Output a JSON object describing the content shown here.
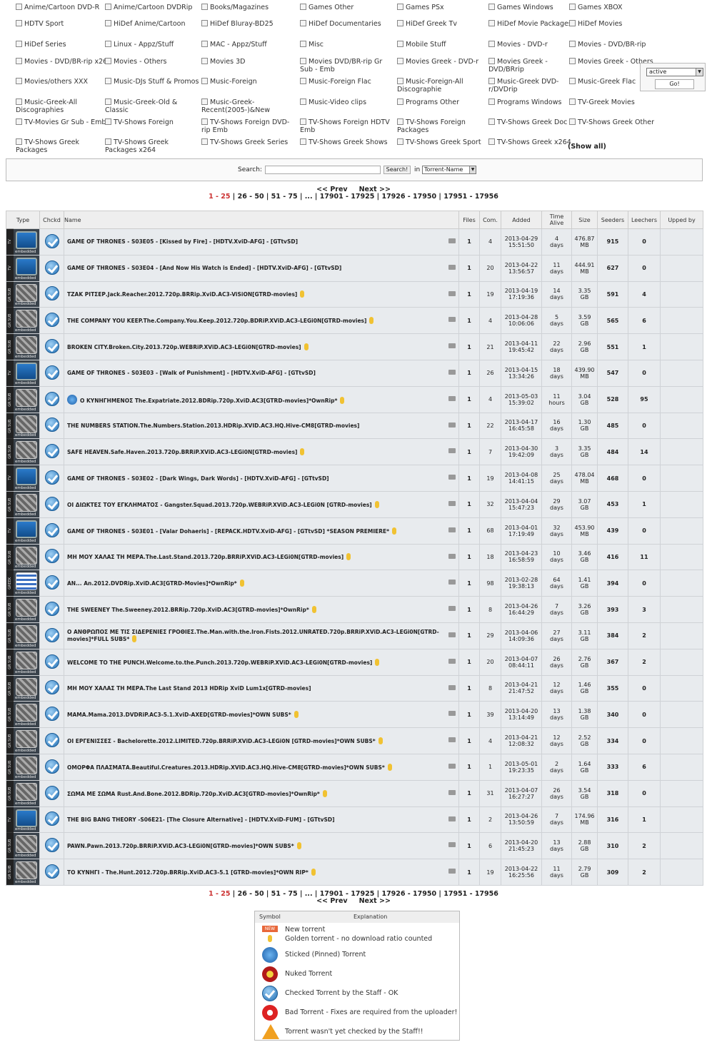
{
  "categories": [
    [
      "Anime/Cartoon DVD-R",
      "Anime/Cartoon DVDRip",
      "Books/Magazines",
      "Games Other",
      "Games PSx",
      "Games Windows",
      "Games XBOX"
    ],
    [
      "HDTV Sport",
      "HiDef Anime/Cartoon",
      "HiDef Bluray-BD25",
      "HiDef Documentaries",
      "HiDef Greek Tv",
      "HiDef Movie Packages",
      "HiDef Movies"
    ],
    [
      "HiDef Series",
      "Linux - Appz/Stuff",
      "MAC - Appz/Stuff",
      "Misc",
      "Mobile Stuff",
      "Movies - DVD-r",
      "Movies - DVD/BR-rip"
    ],
    [
      "Movies - DVD/BR-rip x264",
      "Movies - Others",
      "Movies 3D",
      "Movies DVD/BR-rip Gr Sub - Emb",
      "Movies Greek - DVD-r",
      "Movies Greek - DVD/BRrip",
      "Movies Greek - Others"
    ],
    [
      "Movies/others XXX",
      "Music-DJs Stuff & Promos",
      "Music-Foreign",
      "Music-Foreign Flac",
      "Music-Foreign-All Discographie",
      "Music-Greek DVD-r/DVDrip",
      "Music-Greek Flac"
    ],
    [
      "Music-Greek-All Discographies",
      "Music-Greek-Old & Classic",
      "Music-Greek-Recent(2005-)&New",
      "Music-Video clips",
      "Programs Other",
      "Programs Windows",
      "TV-Greek Movies"
    ],
    [
      "TV-Movies Gr Sub - Emb",
      "TV-Shows Foreign",
      "TV-Shows Foreign DVD-rip Emb",
      "TV-Shows Foreign HDTV Emb",
      "TV-Shows Foreign Packages",
      "TV-Shows Greek Doc",
      "TV-Shows Greek Other"
    ],
    [
      "TV-Shows Greek Packages",
      "TV-Shows Greek Packages x264",
      "TV-Shows Greek Series",
      "TV-Shows Greek Shows",
      "TV-Shows Greek Sport",
      "TV-Shows Greek x264"
    ]
  ],
  "show_all": "(Show all)",
  "status_select": "active",
  "go_button": "Go!",
  "search": {
    "label": "Search:",
    "button": "Search!",
    "in_label": "in",
    "field": "Torrent-Name"
  },
  "pager": {
    "prev": "<< Prev",
    "next": "Next >>",
    "pages": [
      "1 - 25",
      "26 - 50",
      "51 - 75",
      "...",
      "17901 - 17925",
      "17926 - 17950",
      "17951 - 17956"
    ]
  },
  "columns": [
    "Type",
    "Chckd",
    "Name",
    "Files",
    "Com.",
    "Added",
    "Time Alive",
    "Size",
    "Seeders",
    "Leechers",
    "Upped by"
  ],
  "rows": [
    {
      "type": "tv",
      "side": "TV",
      "name": "GAME OF THRONES - S03E05 - [Kissed by Fire] - [HDTV.XviD-AFG] - [GTtvSD]",
      "gold": false,
      "pin": false,
      "files": "1",
      "com": "4",
      "added1": "2013-04-29",
      "added2": "15:51:50",
      "alive1": "4",
      "alive2": "days",
      "size1": "476.87",
      "size2": "MB",
      "seeders": "915",
      "leechers": "0"
    },
    {
      "type": "tv",
      "side": "TV",
      "name": "GAME OF THRONES - S03E04 - [And Now His Watch is Ended] - [HDTV.XviD-AFG] - [GTtvSD]",
      "gold": false,
      "pin": false,
      "files": "1",
      "com": "20",
      "added1": "2013-04-22",
      "added2": "13:56:57",
      "alive1": "11",
      "alive2": "days",
      "size1": "444.91",
      "size2": "MB",
      "seeders": "627",
      "leechers": "0"
    },
    {
      "type": "mov",
      "side": "GR SUB",
      "name": "ΤΖΑΚ ΡΙΤΣΕΡ.Jack.Reacher.2012.720p.BRRip.XviD.AC3-ViSiON[GTRD-movies]",
      "gold": true,
      "pin": false,
      "files": "1",
      "com": "19",
      "added1": "2013-04-19",
      "added2": "17:19:36",
      "alive1": "14",
      "alive2": "days",
      "size1": "3.35",
      "size2": "GB",
      "seeders": "591",
      "leechers": "4"
    },
    {
      "type": "mov",
      "side": "GR SUB",
      "name": "THE COMPANY YOU KEEP.The.Company.You.Keep.2012.720p.BDRiP.XViD.AC3-LEGi0N[GTRD-movies]",
      "gold": true,
      "pin": false,
      "files": "1",
      "com": "4",
      "added1": "2013-04-28",
      "added2": "10:06:06",
      "alive1": "5",
      "alive2": "days",
      "size1": "3.59",
      "size2": "GB",
      "seeders": "565",
      "leechers": "6"
    },
    {
      "type": "mov",
      "side": "GR SUB",
      "name": "BROKEN CITY.Broken.City.2013.720p.WEBRiP.XViD.AC3-LEGi0N[GTRD-movies]",
      "gold": true,
      "pin": false,
      "files": "1",
      "com": "21",
      "added1": "2013-04-11",
      "added2": "19:45:42",
      "alive1": "22",
      "alive2": "days",
      "size1": "2.96",
      "size2": "GB",
      "seeders": "551",
      "leechers": "1"
    },
    {
      "type": "tv",
      "side": "TV",
      "name": "GAME OF THRONES - S03E03 - [Walk of Punishment] - [HDTV.XviD-AFG] - [GTtvSD]",
      "gold": false,
      "pin": false,
      "files": "1",
      "com": "26",
      "added1": "2013-04-15",
      "added2": "13:34:26",
      "alive1": "18",
      "alive2": "days",
      "size1": "439.90",
      "size2": "MB",
      "seeders": "547",
      "leechers": "0"
    },
    {
      "type": "mov",
      "side": "GR SUB",
      "name": "Ο ΚΥΝΗΓΗΜΕΝΟΣ The.Expatriate.2012.BDRip.720p.XviD.AC3[GTRD-movies]*OwnRip*",
      "gold": true,
      "pin": true,
      "files": "1",
      "com": "4",
      "added1": "2013-05-03",
      "added2": "15:39:02",
      "alive1": "11",
      "alive2": "hours",
      "size1": "3.04",
      "size2": "GB",
      "seeders": "528",
      "leechers": "95"
    },
    {
      "type": "mov",
      "side": "GR SUB",
      "name": "THE NUMBERS STATION.The.Numbers.Station.2013.HDRip.XVID.AC3.HQ.Hive-CM8[GTRD-movies]",
      "gold": false,
      "pin": false,
      "files": "1",
      "com": "22",
      "added1": "2013-04-17",
      "added2": "16:45:58",
      "alive1": "16",
      "alive2": "days",
      "size1": "1.30",
      "size2": "GB",
      "seeders": "485",
      "leechers": "0"
    },
    {
      "type": "mov",
      "side": "GR SUB",
      "name": "SAFE HEAVEN.Safe.Haven.2013.720p.BRRiP.XViD.AC3-LEGi0N[GTRD-movies]",
      "gold": true,
      "pin": false,
      "files": "1",
      "com": "7",
      "added1": "2013-04-30",
      "added2": "19:42:09",
      "alive1": "3",
      "alive2": "days",
      "size1": "3.35",
      "size2": "GB",
      "seeders": "484",
      "leechers": "14"
    },
    {
      "type": "tv",
      "side": "TV",
      "name": "GAME OF THRONES - S03E02 - [Dark Wings, Dark Words] - [HDTV.XviD-AFG] - [GTtvSD]",
      "gold": false,
      "pin": false,
      "files": "1",
      "com": "19",
      "added1": "2013-04-08",
      "added2": "14:41:15",
      "alive1": "25",
      "alive2": "days",
      "size1": "478.04",
      "size2": "MB",
      "seeders": "468",
      "leechers": "0"
    },
    {
      "type": "mov",
      "side": "GR SUB",
      "name": "ΟΙ ΔΙΩΚΤΕΣ ΤΟΥ ΕΓΚΛΗΜΑΤΟΣ - Gangster.Squad.2013.720p.WEBRiP.XViD.AC3-LEGi0N [GTRD-movies]",
      "gold": true,
      "pin": false,
      "files": "1",
      "com": "32",
      "added1": "2013-04-04",
      "added2": "15:47:23",
      "alive1": "29",
      "alive2": "days",
      "size1": "3.07",
      "size2": "GB",
      "seeders": "453",
      "leechers": "1"
    },
    {
      "type": "tv",
      "side": "TV",
      "name": "GAME OF THRONES - S03E01 - [Valar Dohaeris] - [REPACK.HDTV.XviD-AFG] - [GTtvSD] *SEASON PREMIERE*",
      "gold": true,
      "pin": false,
      "files": "1",
      "com": "68",
      "added1": "2013-04-01",
      "added2": "17:19:49",
      "alive1": "32",
      "alive2": "days",
      "size1": "453.90",
      "size2": "MB",
      "seeders": "439",
      "leechers": "0"
    },
    {
      "type": "mov",
      "side": "GR SUB",
      "name": "ΜΗ ΜΟΥ ΧΑΛΑΣ ΤΗ ΜΕΡΑ.The.Last.Stand.2013.720p.BRRiP.XViD.AC3-LEGi0N[GTRD-movies]",
      "gold": true,
      "pin": false,
      "files": "1",
      "com": "18",
      "added1": "2013-04-23",
      "added2": "16:58:59",
      "alive1": "10",
      "alive2": "days",
      "size1": "3.46",
      "size2": "GB",
      "seeders": "416",
      "leechers": "11"
    },
    {
      "type": "gr",
      "side": "GREEK",
      "name": "AN... An.2012.DVDRip.XviD.AC3[GTRD-Movies]*OwnRip*",
      "gold": true,
      "pin": false,
      "files": "1",
      "com": "98",
      "added1": "2013-02-28",
      "added2": "19:38:13",
      "alive1": "64",
      "alive2": "days",
      "size1": "1.41",
      "size2": "GB",
      "seeders": "394",
      "leechers": "0"
    },
    {
      "type": "mov",
      "side": "GR SUB",
      "name": "THE SWEENEY The.Sweeney.2012.BRRip.720p.XviD.AC3[GTRD-movies]*OwnRip*",
      "gold": true,
      "pin": false,
      "files": "1",
      "com": "8",
      "added1": "2013-04-26",
      "added2": "16:44:29",
      "alive1": "7",
      "alive2": "days",
      "size1": "3.26",
      "size2": "GB",
      "seeders": "393",
      "leechers": "3"
    },
    {
      "type": "mov",
      "side": "GR SUB",
      "name": "Ο ΑΝΘΡΩΠΟΣ ΜΕ ΤΙΣ ΣΙΔΕΡΕΝΙΕΣ ΓΡΟΘΙΕΣ.The.Man.with.the.Iron.Fists.2012.UNRATED.720p.BRRiP.XViD.AC3-LEGi0N[GTRD-movies]*FULL SUBS*",
      "gold": true,
      "pin": false,
      "files": "1",
      "com": "29",
      "added1": "2013-04-06",
      "added2": "14:09:36",
      "alive1": "27",
      "alive2": "days",
      "size1": "3.11",
      "size2": "GB",
      "seeders": "384",
      "leechers": "2"
    },
    {
      "type": "mov",
      "side": "GR SUB",
      "name": "WELCOME TO THE PUNCH.Welcome.to.the.Punch.2013.720p.WEBRiP.XViD.AC3-LEGi0N[GTRD-movies]",
      "gold": true,
      "pin": false,
      "files": "1",
      "com": "20",
      "added1": "2013-04-07",
      "added2": "08:44:11",
      "alive1": "26",
      "alive2": "days",
      "size1": "2.76",
      "size2": "GB",
      "seeders": "367",
      "leechers": "2"
    },
    {
      "type": "mov",
      "side": "GR SUB",
      "name": "ΜΗ ΜΟΥ ΧΑΛΑΣ ΤΗ ΜΕΡΑ.The Last Stand 2013 HDRip XviD Lum1x[GTRD-movies]",
      "gold": false,
      "pin": false,
      "files": "1",
      "com": "8",
      "added1": "2013-04-21",
      "added2": "21:47:52",
      "alive1": "12",
      "alive2": "days",
      "size1": "1.46",
      "size2": "GB",
      "seeders": "355",
      "leechers": "0"
    },
    {
      "type": "mov",
      "side": "GR SUB",
      "name": "MAMA.Mama.2013.DVDRiP.AC3-5.1.XviD-AXED[GTRD-movies]*OWN SUBS*",
      "gold": true,
      "pin": false,
      "files": "1",
      "com": "39",
      "added1": "2013-04-20",
      "added2": "13:14:49",
      "alive1": "13",
      "alive2": "days",
      "size1": "1.38",
      "size2": "GB",
      "seeders": "340",
      "leechers": "0"
    },
    {
      "type": "mov",
      "side": "GR SUB",
      "name": "ΟΙ ΕΡΓΕΝΙΣΣΕΣ - Bachelorette.2012.LIMITED.720p.BRRiP.XViD.AC3-LEGi0N [GTRD-movies]*OWN SUBS*",
      "gold": true,
      "pin": false,
      "files": "1",
      "com": "4",
      "added1": "2013-04-21",
      "added2": "12:08:32",
      "alive1": "12",
      "alive2": "days",
      "size1": "2.52",
      "size2": "GB",
      "seeders": "334",
      "leechers": "0"
    },
    {
      "type": "mov",
      "side": "GR SUB",
      "name": "ΟΜΟΡΦΑ ΠΛΑΣΜΑΤΑ.Beautiful.Creatures.2013.HDRip.XVID.AC3.HQ.Hive-CM8[GTRD-movies]*OWN SUBS*",
      "gold": true,
      "pin": false,
      "files": "1",
      "com": "1",
      "added1": "2013-05-01",
      "added2": "19:23:35",
      "alive1": "2",
      "alive2": "days",
      "size1": "1.64",
      "size2": "GB",
      "seeders": "333",
      "leechers": "6"
    },
    {
      "type": "mov",
      "side": "GR SUB",
      "name": "ΣΩΜΑ ΜΕ ΣΩΜΑ Rust.And.Bone.2012.BDRip.720p.XviD.AC3[GTRD-movies]*OwnRip*",
      "gold": true,
      "pin": false,
      "files": "1",
      "com": "31",
      "added1": "2013-04-07",
      "added2": "16:27:27",
      "alive1": "26",
      "alive2": "days",
      "size1": "3.54",
      "size2": "GB",
      "seeders": "318",
      "leechers": "0"
    },
    {
      "type": "tv",
      "side": "TV",
      "name": "THE BIG BANG THEORY -S06E21- [The Closure Alternative] - [HDTV.XviD-FUM] - [GTtvSD]",
      "gold": false,
      "pin": false,
      "files": "1",
      "com": "2",
      "added1": "2013-04-26",
      "added2": "13:50:59",
      "alive1": "7",
      "alive2": "days",
      "size1": "174.96",
      "size2": "MB",
      "seeders": "316",
      "leechers": "1"
    },
    {
      "type": "mov",
      "side": "GR SUB",
      "name": "PAWN.Pawn.2013.720p.BRRiP.XViD.AC3-LEGi0N[GTRD-movies]*OWN SUBS*",
      "gold": true,
      "pin": false,
      "files": "1",
      "com": "6",
      "added1": "2013-04-20",
      "added2": "21:45:23",
      "alive1": "13",
      "alive2": "days",
      "size1": "2.88",
      "size2": "GB",
      "seeders": "310",
      "leechers": "2"
    },
    {
      "type": "mov",
      "side": "GR SUB",
      "name": "ΤΟ ΚΥΝΗΓΙ - The.Hunt.2012.720p.BRRip.XviD.AC3-5.1 [GTRD-movies]*OWN RIP*",
      "gold": true,
      "pin": false,
      "files": "1",
      "com": "19",
      "added1": "2013-04-22",
      "added2": "16:25:56",
      "alive1": "11",
      "alive2": "days",
      "size1": "2.79",
      "size2": "GB",
      "seeders": "309",
      "leechers": "2"
    }
  ],
  "embedded_label": "embedded",
  "legend": {
    "col_symbol": "Symbol",
    "col_explanation": "Explanation",
    "new_badge": "NEW",
    "items": [
      "New torrent",
      "Golden torrent - no download ratio counted",
      "Sticked (Pinned) Torrent",
      "Nuked Torrent",
      "Checked Torrent by the Staff - OK",
      "Bad Torrent - Fixes are required from the uploader!",
      "Torrent wasn't yet checked by the Staff!!"
    ]
  },
  "colors": {
    "accent": "#cc3333",
    "row_bg": "#e8ebee",
    "check_blue": "#1f6eb4",
    "gold": "#f1c232"
  }
}
